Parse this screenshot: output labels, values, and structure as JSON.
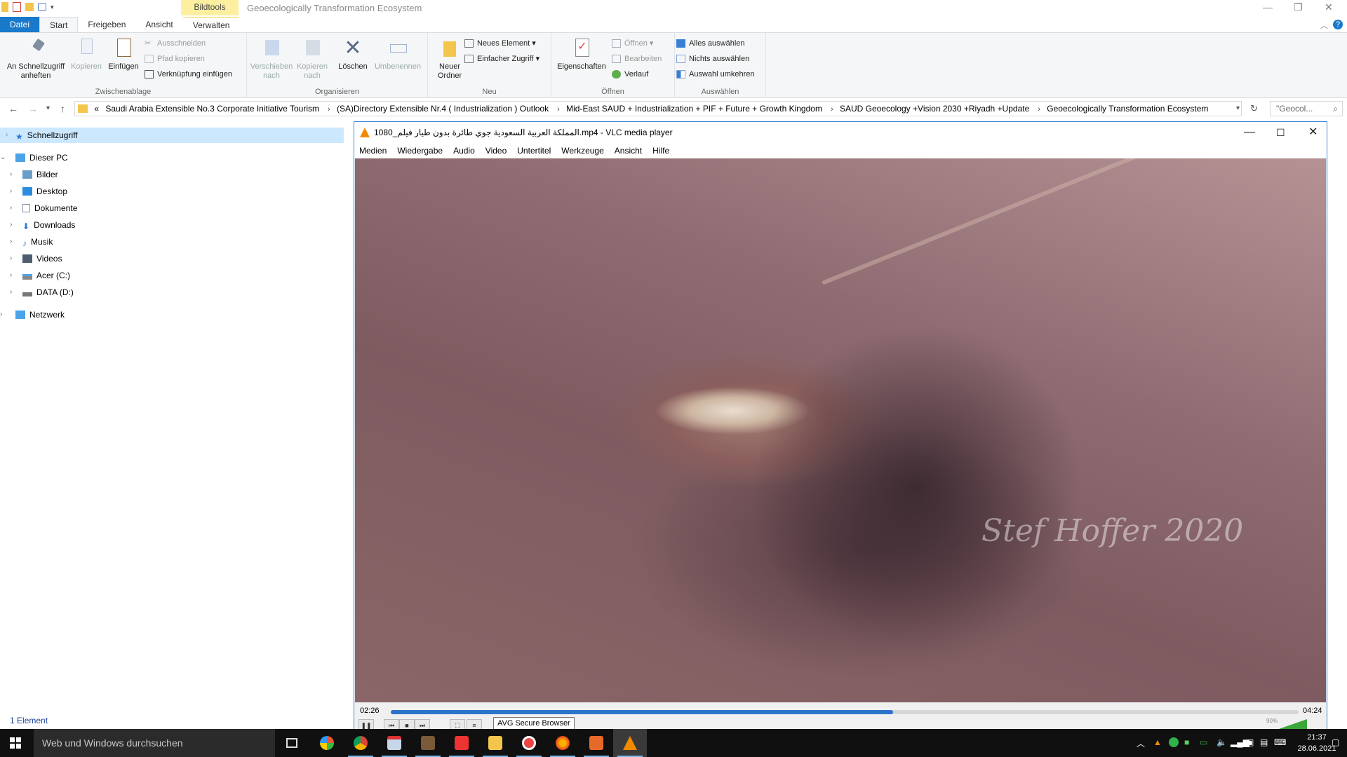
{
  "explorer": {
    "window_title": "Geoecologically Transformation Ecosystem",
    "contextual_tab": "Bildtools",
    "tabs": [
      "Datei",
      "Start",
      "Freigeben",
      "Ansicht",
      "Verwalten"
    ],
    "ribbon": {
      "clipboard": {
        "pin": "An Schnellzugriff anheften",
        "copy": "Kopieren",
        "paste": "Einfügen",
        "cut": "Ausschneiden",
        "copy_path": "Pfad kopieren",
        "paste_shortcut": "Verknüpfung einfügen",
        "label": "Zwischenablage"
      },
      "organize": {
        "move": "Verschieben nach",
        "copy_to": "Kopieren nach",
        "delete": "Löschen",
        "rename": "Umbenennen",
        "label": "Organisieren"
      },
      "new": {
        "new_folder": "Neuer Ordner",
        "new_item": "Neues Element",
        "easy_access": "Einfacher Zugriff",
        "label": "Neu"
      },
      "open": {
        "properties": "Eigenschaften",
        "open": "Öffnen",
        "edit": "Bearbeiten",
        "history": "Verlauf",
        "label": "Öffnen"
      },
      "select": {
        "select_all": "Alles auswählen",
        "select_none": "Nichts auswählen",
        "invert": "Auswahl umkehren",
        "label": "Auswählen"
      }
    },
    "address": {
      "prefix": "«",
      "crumbs": [
        "Saudi Arabia Extensible No.3 Corporate Initiative Tourism",
        "(SA)Directory Extensible Nr.4 ( Industrialization ) Outlook",
        "Mid-East SAUD + Industrialization + PIF + Future + Growth Kingdom",
        "SAUD Geoecology +Vision 2030 +Riyadh +Update",
        "Geoecologically Transformation Ecosystem"
      ],
      "search_placeholder": "\"Geocol..."
    },
    "nav": {
      "quick_access": "Schnellzugriff",
      "this_pc": "Dieser PC",
      "items": [
        "Bilder",
        "Desktop",
        "Dokumente",
        "Downloads",
        "Musik",
        "Videos",
        "Acer (C:)",
        "DATA (D:)"
      ],
      "network": "Netzwerk"
    },
    "status": "1 Element"
  },
  "vlc": {
    "title": "المملكة العربية السعودية جوي طائرة بدون طيار فيلم_1080.mp4 - VLC media player",
    "menu": [
      "Medien",
      "Wiedergabe",
      "Audio",
      "Video",
      "Untertitel",
      "Werkzeuge",
      "Ansicht",
      "Hilfe"
    ],
    "watermark": "Stef Hoffer 2020",
    "time_elapsed": "02:26",
    "time_total": "04:24",
    "progress": 0.553,
    "tooltip": "AVG Secure Browser",
    "volume": "90%"
  },
  "taskbar": {
    "search_placeholder": "Web und Windows durchsuchen",
    "time": "21:37",
    "date": "28.06.2021"
  },
  "colors": {
    "accent": "#1979ca",
    "bildtools": "#fcf0a0",
    "vlc_orange": "#f28a00",
    "seek_fill": "#2c74c9"
  }
}
